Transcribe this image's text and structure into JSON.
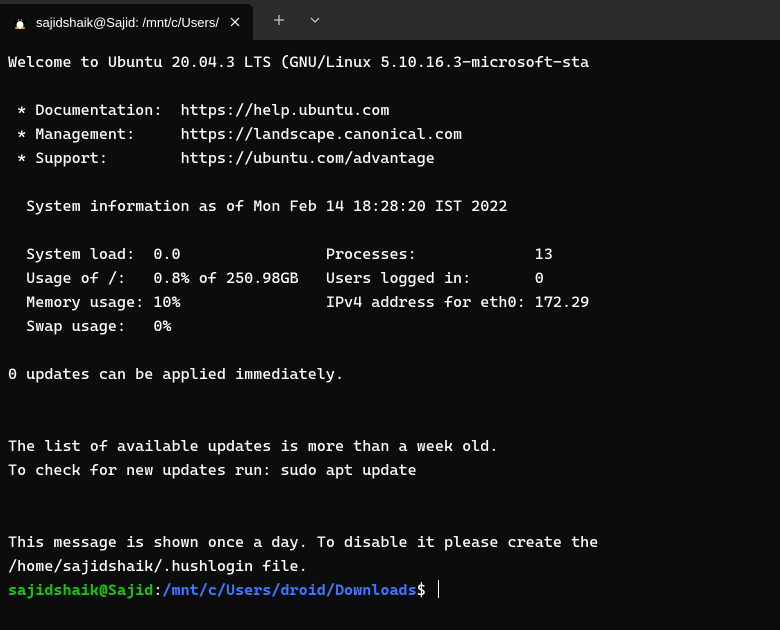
{
  "tab": {
    "title": "sajidshaik@Sajid: /mnt/c/Users/"
  },
  "welcome": "Welcome to Ubuntu 20.04.3 LTS (GNU/Linux 5.10.16.3-microsoft-sta",
  "links": {
    "doc_label": " * Documentation:  ",
    "doc_url": "https://help.ubuntu.com",
    "mgmt_label": " * Management:     ",
    "mgmt_url": "https://landscape.canonical.com",
    "support_label": " * Support:        ",
    "support_url": "https://ubuntu.com/advantage"
  },
  "sysinfo_header": "  System information as of Mon Feb 14 18:28:20 IST 2022",
  "sysinfo": {
    "line1": "  System load:  0.0                Processes:             13",
    "line2": "  Usage of /:   0.8% of 250.98GB   Users logged in:       0",
    "line3": "  Memory usage: 10%                IPv4 address for eth0: 172.29",
    "line4": "  Swap usage:   0%"
  },
  "updates": "0 updates can be applied immediately.",
  "updates_old": "The list of available updates is more than a week old.",
  "updates_check": "To check for new updates run: sudo apt update",
  "message_daily": "This message is shown once a day. To disable it please create the",
  "hushlogin": "/home/sajidshaik/.hushlogin file.",
  "prompt": {
    "user": "sajidshaik@Sajid",
    "colon": ":",
    "path": "/mnt/c/Users/droid/Downloads",
    "dollar": "$"
  }
}
